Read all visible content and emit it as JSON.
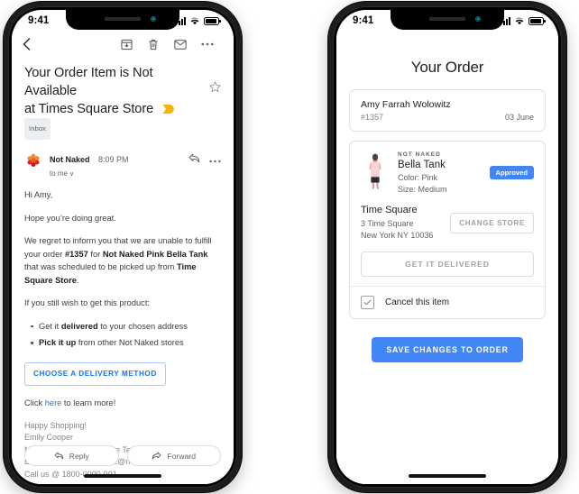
{
  "status_bar": {
    "time": "9:41",
    "signal_icon": "signal-bars-icon",
    "wifi_icon": "wifi-icon",
    "battery_icon": "battery-icon"
  },
  "email_phone": {
    "toolbar": {
      "back_icon": "back-chevron-icon",
      "archive_icon": "archive-icon",
      "delete_icon": "trash-icon",
      "mark_unread_icon": "envelope-icon",
      "more_icon": "more-options-icon"
    },
    "subject": {
      "line1": "Your Order Item is Not Available",
      "line2": "at Times Square Store",
      "important_marker_icon": "important-chevron-icon",
      "label": "Inbox",
      "star_icon": "star-outline-icon"
    },
    "sender": {
      "avatar_icon": "not-naked-logo-avatar",
      "name": "Not Naked",
      "time": "8:09 PM",
      "recipients": "to me",
      "recipients_caret": "∨",
      "reply_icon": "reply-arrow-icon",
      "more_icon": "more-options-icon"
    },
    "body": {
      "greeting": "Hi Amy,",
      "line_hope": "Hope you’re doing great.",
      "regret": {
        "part1": "We regret to inform you that we are unable to fulfill your order ",
        "order_id": "#1357",
        "part2": " for ",
        "product": "Not Naked Pink Bella Tank",
        "part3": " that was scheduled to be picked up from ",
        "store": "Time Square Store",
        "part4": "."
      },
      "wish_intro": "If you still wish to get this product:",
      "bullets": [
        {
          "pre": "Get it ",
          "bold": "delivered",
          "post": " to your chosen address"
        },
        {
          "pre": "",
          "bold": "Pick it up",
          "post": " from other Not Naked stores"
        }
      ],
      "cta_label": "CHOOSE A  DELIVERY METHOD",
      "learn_pre": "Click ",
      "learn_link": "here",
      "learn_post": " to learn more!",
      "signature": [
        "Happy Shopping!",
        "Emily Cooper",
        "Not Naked Customer Care Team",
        "Email us @ customercare@notnaked.com",
        "Call us @ 1800-0000-991"
      ]
    },
    "footer": {
      "reply_label": "Reply",
      "reply_icon": "reply-arrow-icon",
      "forward_label": "Forward",
      "forward_icon": "forward-arrow-icon"
    }
  },
  "order_phone": {
    "title": "Your Order",
    "customer": {
      "name": "Amy Farrah Wolowitz",
      "order_id": "#1357",
      "date": "03 June"
    },
    "item": {
      "thumbnail_icon": "pink-tank-product-photo",
      "brand": "NOT NAKED",
      "product": "Bella Tank",
      "color": "Color: Pink",
      "size": "Size: Medium",
      "status_badge": "Approved",
      "badge_color": "#4285f4"
    },
    "store": {
      "name": "Time Square",
      "address_line1": "3 Time Square",
      "address_line2": "New York NY 10036",
      "change_label": "CHANGE STORE"
    },
    "deliver_label": "GET IT DELIVERED",
    "cancel": {
      "label": "Cancel this item",
      "checked": true,
      "check_icon": "checkmark-icon"
    },
    "save_label": "SAVE CHANGES TO ORDER"
  }
}
